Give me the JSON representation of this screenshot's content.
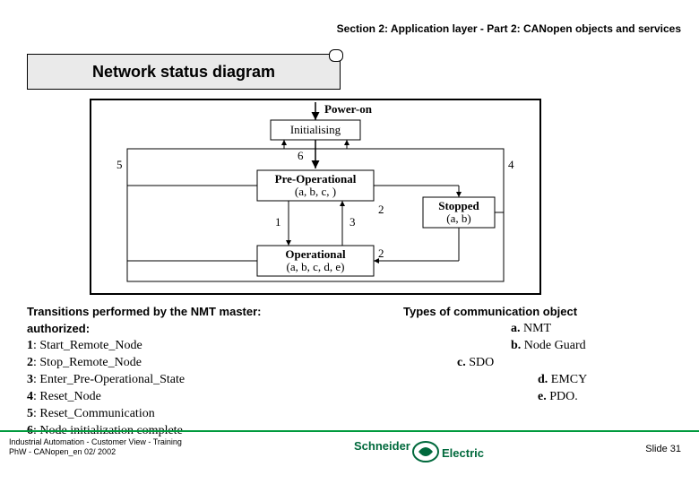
{
  "header": "Section 2: Application layer - Part 2: CANopen objects and services",
  "title": "Network status diagram",
  "diagram": {
    "power_on": "Power-on",
    "initialising": "Initialising",
    "pre_op": "Pre-Operational",
    "pre_op_sub": "(a, b, c, )",
    "stopped": "Stopped",
    "stopped_sub": "(a, b)",
    "operational": "Operational",
    "operational_sub": "(a, b, c, d, e)",
    "n1": "1",
    "n2": "2",
    "n3": "3",
    "n4": "4",
    "n5": "5",
    "n6": "6"
  },
  "left": {
    "head1": "Transitions performed by the NMT master:",
    "head2": "authorized:",
    "l1b": "1",
    "l1": ": Start_Remote_Node",
    "l2b": "2",
    "l2": ": Stop_Remote_Node",
    "l3b": "3",
    "l3": ": Enter_Pre-Operational_State",
    "l4b": "4",
    "l4": ": Reset_Node",
    "l5b": "5",
    "l5": ": Reset_Communication",
    "l6b": "6",
    "l6": ": Node initialization complete"
  },
  "right": {
    "head": "Types of communication object",
    "r1b": "a.",
    "r1": " NMT",
    "r2b": "b.",
    "r2": " Node Guard",
    "r3b": "c.",
    "r3": " SDO",
    "r4b": "d.",
    "r4": " EMCY",
    "r5b": "e.",
    "r5": " PDO."
  },
  "footer": {
    "l1": "Industrial Automation -  Customer View -  Training",
    "l2": "PhW  -  CANopen_en   02/ 2002",
    "slide": "Slide 31",
    "brand1": "Schneider",
    "brand2": "Electric"
  }
}
